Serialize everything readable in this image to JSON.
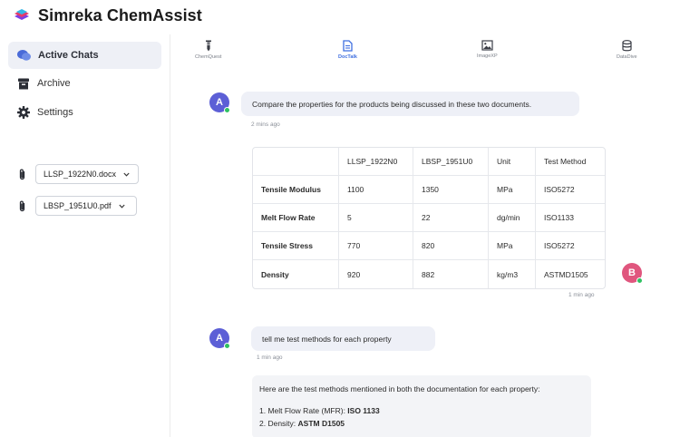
{
  "app": {
    "title": "Simreka ChemAssist"
  },
  "sidebar": {
    "items": [
      {
        "label": "Active Chats",
        "icon": "chat-bubbles-icon",
        "active": true
      },
      {
        "label": "Archive",
        "icon": "archive-box-icon"
      },
      {
        "label": "Settings",
        "icon": "gear-icon"
      }
    ],
    "files": [
      {
        "name": "LLSP_1922N0.docx",
        "icon": "paperclip-icon"
      },
      {
        "name": "LBSP_1951U0.pdf",
        "icon": "paperclip-icon"
      }
    ]
  },
  "tabs": [
    {
      "label": "ChemQuest",
      "icon": "flask-icon"
    },
    {
      "label": "DocTalk",
      "icon": "document-icon",
      "active": true
    },
    {
      "label": "ImageXP",
      "icon": "image-icon"
    },
    {
      "label": "DataDive",
      "icon": "database-icon"
    }
  ],
  "chat": {
    "msg1": {
      "avatar": "A",
      "text": "Compare the properties for the products being discussed in these two documents.",
      "time": "2 mins ago"
    },
    "reply1": {
      "avatar": "B",
      "time": "1 min ago",
      "table": {
        "headers": [
          "",
          "LLSP_1922N0",
          "LBSP_1951U0",
          "Unit",
          "Test Method"
        ],
        "rows": [
          [
            "Tensile Modulus",
            "1100",
            "1350",
            "MPa",
            "ISO5272"
          ],
          [
            "Melt Flow Rate",
            "5",
            "22",
            "dg/min",
            "ISO1133"
          ],
          [
            "Tensile Stress",
            "770",
            "820",
            "MPa",
            "ISO5272"
          ],
          [
            "Density",
            "920",
            "882",
            "kg/m3",
            "ASTMD1505"
          ]
        ]
      }
    },
    "msg2": {
      "avatar": "A",
      "text": "tell me test methods for each property",
      "time": "1 min ago"
    },
    "reply2": {
      "intro": "Here are the test methods mentioned in both the documentation for each property:",
      "items": [
        {
          "prefix": "1.  Melt Flow Rate (MFR): ",
          "value": "ISO 1133"
        },
        {
          "prefix": "2. Density: ",
          "value": "ASTM D1505"
        }
      ]
    }
  },
  "colors": {
    "accent": "#3f6fe0",
    "avatarA": "#5c5fd6",
    "avatarB": "#e0567e",
    "online": "#2fc162"
  }
}
